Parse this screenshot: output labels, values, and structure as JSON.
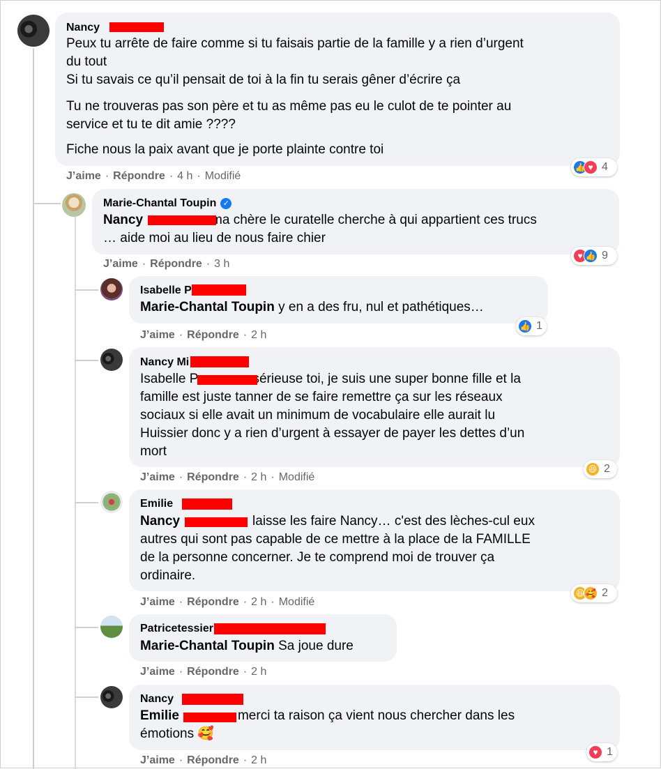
{
  "actions": {
    "like": "J’aime",
    "reply": "Répondre",
    "edited": "Modifié",
    "sep": "·"
  },
  "comments": [
    {
      "author": "Nancy",
      "lines": [
        "Peux tu arrête de faire comme si tu faisais partie de la famille y a rien d’urgent",
        "du tout",
        "Si tu savais ce qu’il pensait de toi à la fin tu serais gêner d’écrire ça",
        "Tu ne trouveras pas son père et tu as même pas eu le culot de te pointer au",
        "service et tu te dit amie ????",
        "Fiche nous la paix avant que je porte plainte contre toi"
      ],
      "time": "4 h",
      "reactions": {
        "icons": [
          "like",
          "love"
        ],
        "count": "4"
      }
    },
    {
      "author": "Marie-Chantal Toupin",
      "mention": "Nancy",
      "lines": [
        "ma chère le curatelle cherche à qui appartient ces trucs",
        "… aide moi au lieu de nous faire chier"
      ],
      "time": "3 h",
      "reactions": {
        "icons": [
          "love",
          "like"
        ],
        "count": "9"
      }
    },
    {
      "author": "Isabelle P",
      "mention": "Marie-Chantal Toupin",
      "lines": [
        "y en a des fru, nul et pathétiques…"
      ],
      "time": "2 h",
      "reactions": {
        "icons": [
          "like"
        ],
        "count": "1"
      }
    },
    {
      "author": "Nancy Mi",
      "mention": "Isabelle P",
      "lines": [
        "sérieuse toi, je suis une super bonne fille et la",
        "famille est juste tanner de se faire remettre ça sur les réseaux",
        "sociaux si elle avait un minimum de vocabulaire elle aurait lu",
        "Huissier donc y a rien d’urgent à essayer de payer les dettes d’un",
        "mort"
      ],
      "time": "2 h",
      "reactions": {
        "icons": [
          "haha"
        ],
        "count": "2"
      }
    },
    {
      "author": "Emilie",
      "mention": "Nancy",
      "lines": [
        "laisse les faire Nancy… c'est des lèches-cul eux",
        "autres qui sont pas capable de ce mettre à la place de la FAMILLE",
        "de la personne concerner. Je te comprend moi de trouver ça",
        "ordinaire."
      ],
      "time": "2 h",
      "reactions": {
        "icons": [
          "haha",
          "care"
        ],
        "count": "2"
      }
    },
    {
      "author": "Patricetessier",
      "mention": "Marie-Chantal Toupin",
      "lines": [
        "Sa joue dure"
      ],
      "time": "2 h"
    },
    {
      "author": "Nancy",
      "mention": "Emilie",
      "lines": [
        "merci ta raison ça vient nous chercher dans les",
        "émotions 🥰"
      ],
      "time": "2 h",
      "reactions": {
        "icons": [
          "love"
        ],
        "count": "1"
      }
    }
  ],
  "icons": {
    "like": "👍",
    "love": "♥",
    "haha": "😆",
    "care": "🥰",
    "verified": "✓"
  },
  "colors": {
    "bubble": "#f0f2f5",
    "meta": "#65676b",
    "like": "#1877f2",
    "love": "#f33e58",
    "redaction": "#ff0000"
  }
}
